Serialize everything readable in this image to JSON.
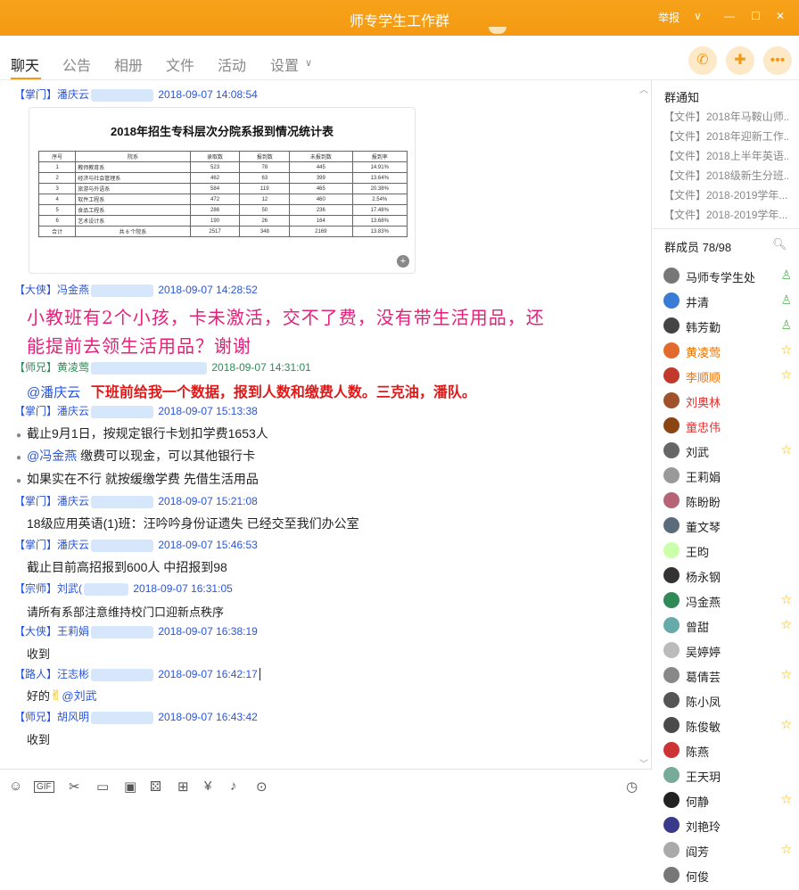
{
  "window": {
    "title": "师专学生工作群",
    "report": "举报",
    "chevron": "∨",
    "min": "—",
    "max": "☐",
    "close": "✕"
  },
  "tabs": [
    "聊天",
    "公告",
    "相册",
    "文件",
    "活动",
    "设置"
  ],
  "table": {
    "title": "2018年招生专科层次分院系报到情况统计表",
    "headers": [
      "序号",
      "院系",
      "录取数",
      "报到数",
      "未报到数",
      "报到率"
    ],
    "rows": [
      [
        "1",
        "教师教育系",
        "523",
        "78",
        "445",
        "14.91%"
      ],
      [
        "2",
        "经济与社会管理系",
        "462",
        "63",
        "399",
        "13.64%"
      ],
      [
        "3",
        "旅游与外语系",
        "584",
        "119",
        "465",
        "20.38%"
      ],
      [
        "4",
        "软件工程系",
        "472",
        "12",
        "460",
        "2.54%"
      ],
      [
        "5",
        "食品工程系",
        "286",
        "50",
        "236",
        "17.48%"
      ],
      [
        "6",
        "艺术设计系",
        "190",
        "26",
        "164",
        "13.68%"
      ],
      [
        "合计",
        "共 6 个院系",
        "2517",
        "348",
        "2169",
        "13.83%"
      ]
    ]
  },
  "messages": [
    {
      "tag": "【掌门】",
      "name": "潘庆云",
      "time": "2018-09-07 14:08:54"
    },
    {
      "tag": "【大侠】",
      "name": "冯金燕",
      "time": "2018-09-07 14:28:52",
      "text1": "小教班有2个小孩，卡未激活，交不了费，没有带生活用品，还",
      "text2": "能提前去领生活用品？谢谢"
    },
    {
      "tag": "【师兄】",
      "name": "黄凌莺",
      "time": "2018-09-07 14:31:01",
      "mention": "@潘庆云",
      "text": "下班前给我一个数据，报到人数和缴费人数。三克油，潘队。"
    },
    {
      "tag": "【掌门】",
      "name": "潘庆云",
      "time": "2018-09-07 15:13:38",
      "line1": "截止9月1日，按规定银行卡划扣学费1653人",
      "mention": "@冯金燕",
      "line2": "缴费可以现金，可以其他银行卡",
      "line3": "如果实在不行 就按缓缴学费 先借生活用品"
    },
    {
      "tag": "【掌门】",
      "name": "潘庆云",
      "time": "2018-09-07 15:21:08",
      "text": "18级应用英语(1)班：汪吟吟身份证遗失  已经交至我们办公室"
    },
    {
      "tag": "【掌门】",
      "name": "潘庆云",
      "time": "2018-09-07 15:46:53",
      "text": "截止目前高招报到600人 中招报到98"
    },
    {
      "tag": "【宗师】",
      "name": "刘武(",
      "time": "2018-09-07 16:31:05",
      "text": "请所有系部注意维持校门口迎新点秩序"
    },
    {
      "tag": "【大侠】",
      "name": "王莉娟",
      "time": "2018-09-07 16:38:19",
      "text": "收到"
    },
    {
      "tag": "【路人】",
      "name": "汪志彬",
      "time": "2018-09-07 16:42:17",
      "text": "好的",
      "mention": "@刘武"
    },
    {
      "tag": "【师兄】",
      "name": "胡风明",
      "time": "2018-09-07 16:43:42",
      "text": "收到"
    }
  ],
  "side": {
    "notice_title": "群通知",
    "notices": [
      "【文件】2018年马鞍山师...",
      "【文件】2018年迎新工作...",
      "【文件】2018上半年英语...",
      "【文件】2018级新生分班...",
      "【文件】2018-2019学年...",
      "【文件】2018-2019学年..."
    ],
    "members_title": "群成员 78/98",
    "members": [
      {
        "name": "马师专学生处",
        "badge": "person",
        "style": ""
      },
      {
        "name": "井清",
        "badge": "person",
        "style": ""
      },
      {
        "name": "韩芳勤",
        "badge": "person",
        "style": ""
      },
      {
        "name": "黄凌莺",
        "badge": "star",
        "style": "orange"
      },
      {
        "name": "李顺顺",
        "badge": "star",
        "style": "orange"
      },
      {
        "name": "刘奥林",
        "badge": "",
        "style": "red"
      },
      {
        "name": "童忠伟",
        "badge": "",
        "style": "red"
      },
      {
        "name": "刘武",
        "badge": "star",
        "style": ""
      },
      {
        "name": "王莉娟",
        "badge": "",
        "style": ""
      },
      {
        "name": "陈盼盼",
        "badge": "",
        "style": ""
      },
      {
        "name": "董文琴",
        "badge": "",
        "style": ""
      },
      {
        "name": "王昀",
        "badge": "",
        "style": ""
      },
      {
        "name": "杨永钢",
        "badge": "",
        "style": ""
      },
      {
        "name": "冯金燕",
        "badge": "star",
        "style": ""
      },
      {
        "name": "曾甜",
        "badge": "star",
        "style": ""
      },
      {
        "name": "吴婷婷",
        "badge": "",
        "style": ""
      },
      {
        "name": "葛倩芸",
        "badge": "star",
        "style": ""
      },
      {
        "name": "陈小凤",
        "badge": "",
        "style": ""
      },
      {
        "name": "陈俊敏",
        "badge": "star",
        "style": ""
      },
      {
        "name": "陈燕",
        "badge": "",
        "style": ""
      },
      {
        "name": "王天玥",
        "badge": "",
        "style": ""
      },
      {
        "name": "何静",
        "badge": "star",
        "style": ""
      },
      {
        "name": "刘艳玲",
        "badge": "",
        "style": ""
      },
      {
        "name": "阎芳",
        "badge": "star",
        "style": ""
      },
      {
        "name": "何俊",
        "badge": "",
        "style": ""
      }
    ]
  },
  "colors": {
    "accent": "#f39a12",
    "link": "#2a55d8",
    "pink": "#e6207a",
    "red": "#e01818"
  }
}
